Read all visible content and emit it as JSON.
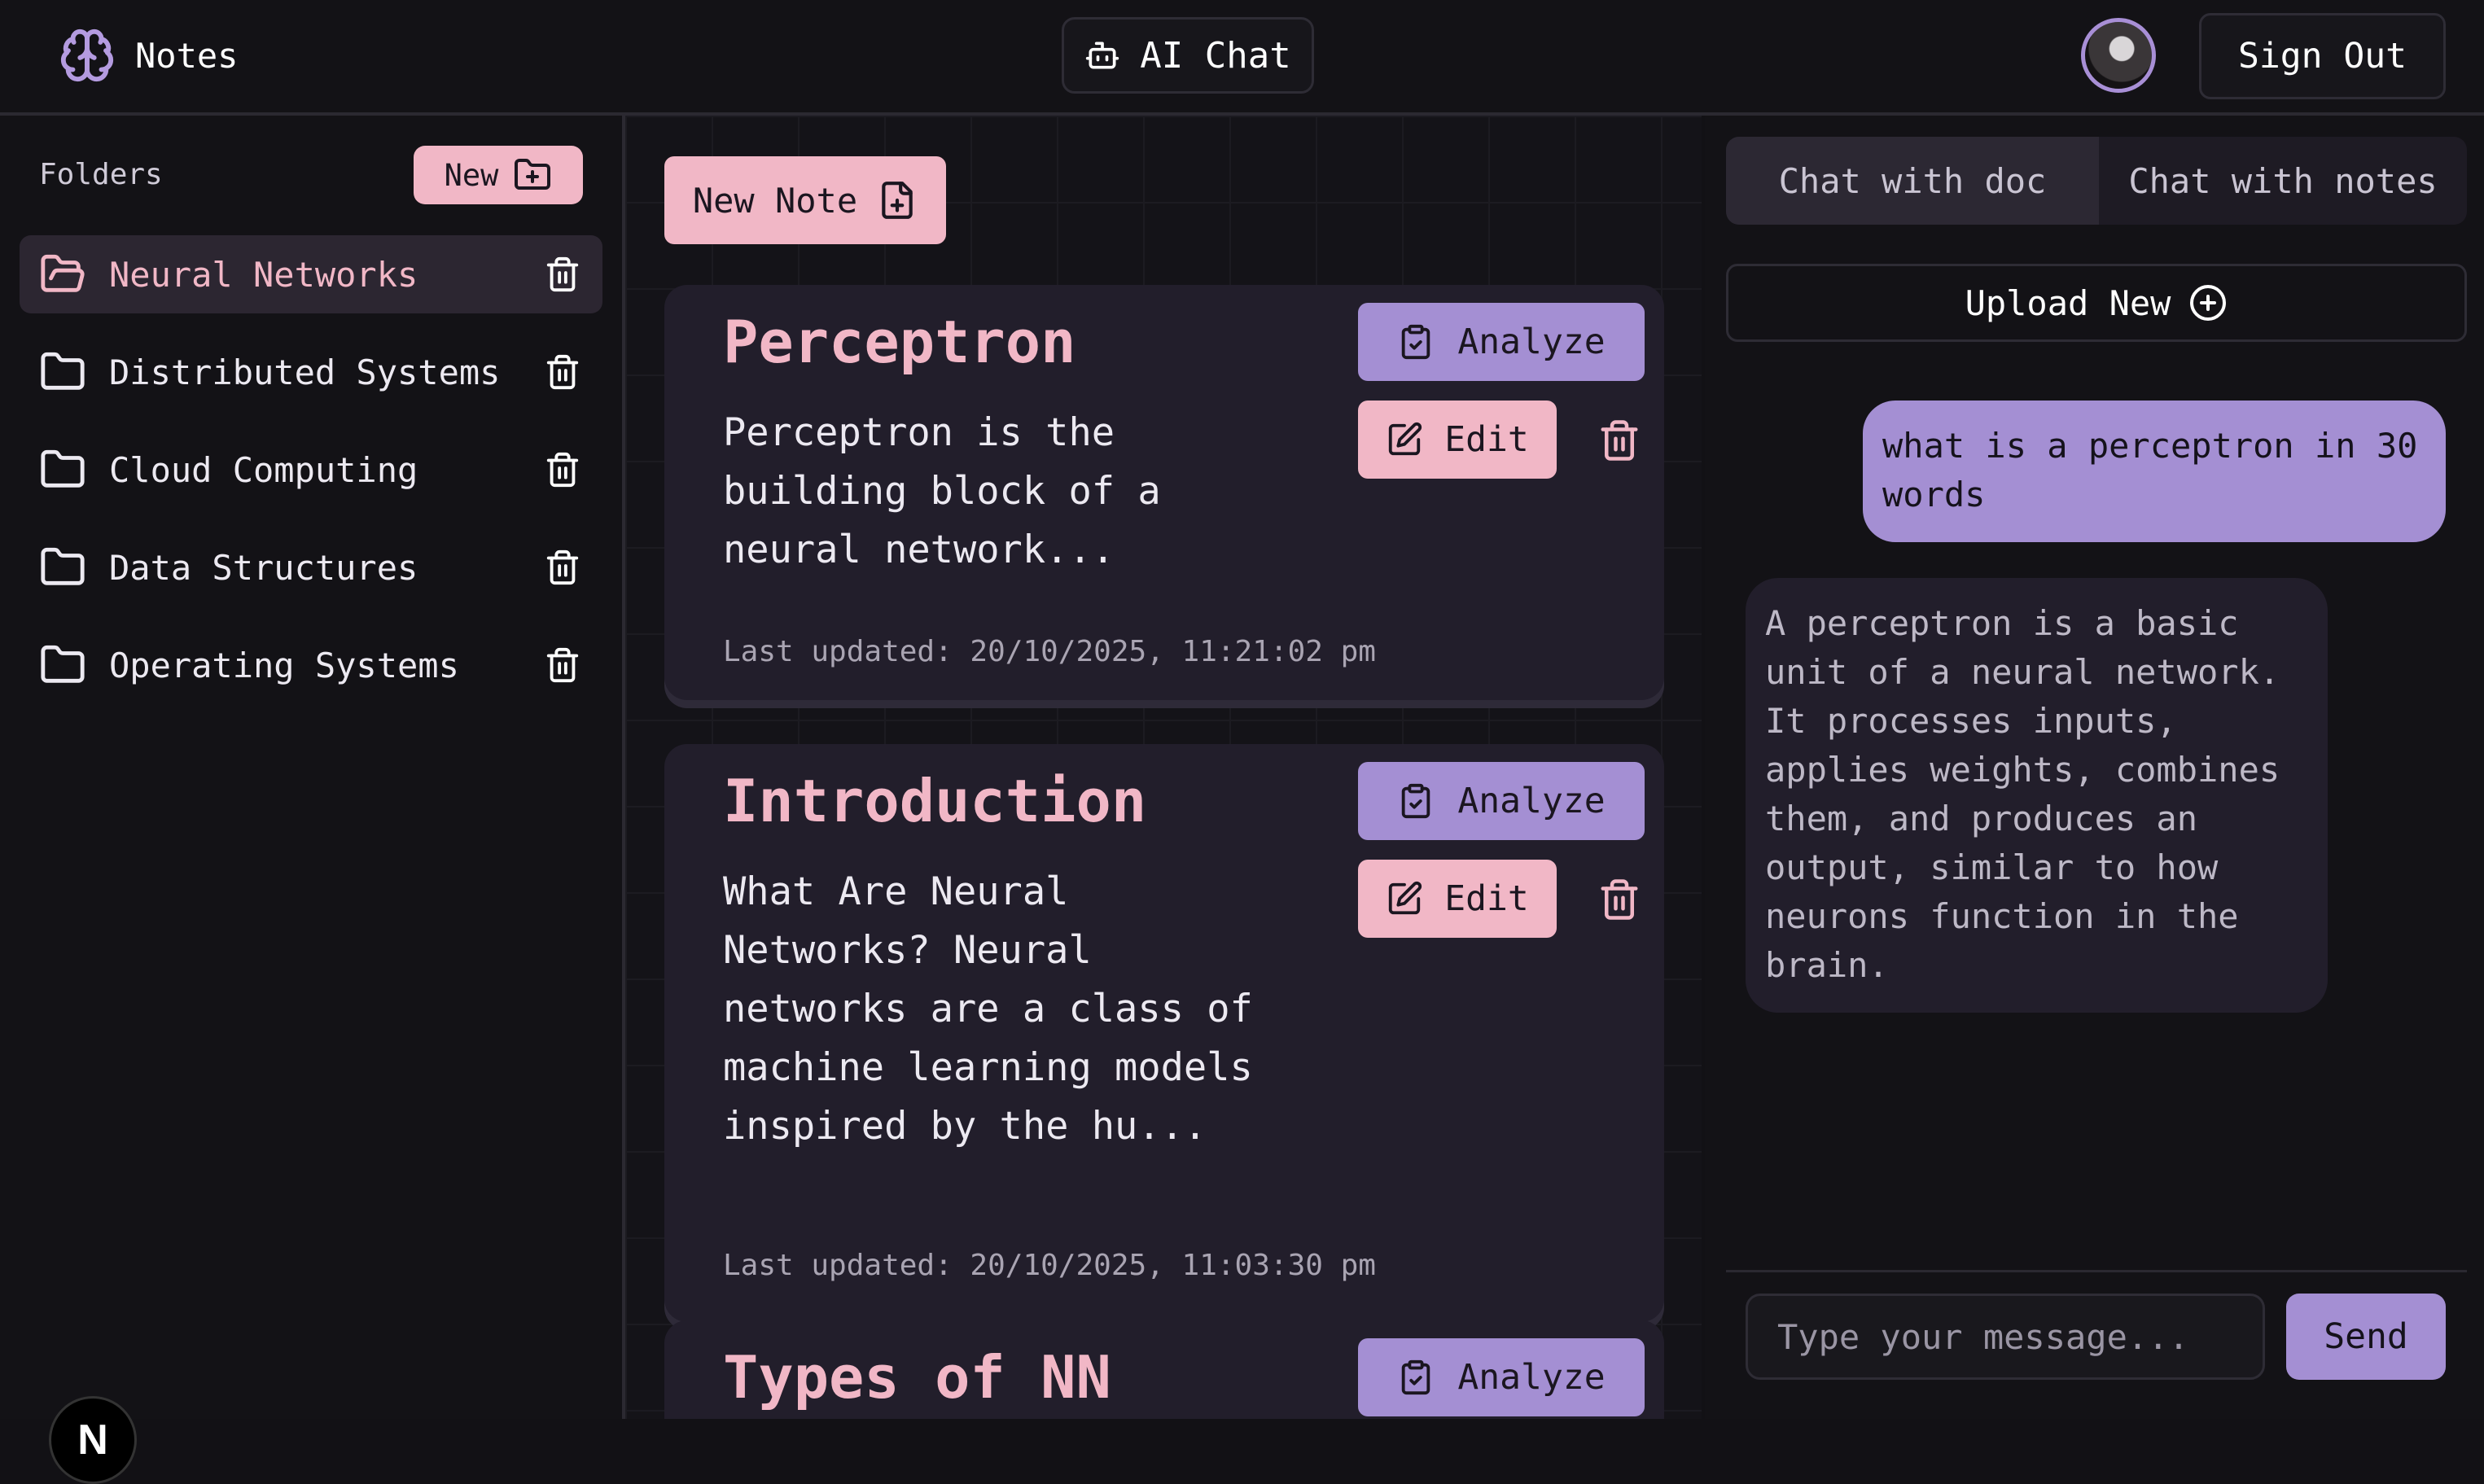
{
  "header": {
    "app_title": "Notes",
    "ai_chat_label": "AI Chat",
    "sign_out_label": "Sign Out"
  },
  "sidebar": {
    "folders_label": "Folders",
    "new_label": "New",
    "folders": [
      {
        "name": "Neural Networks",
        "active": true
      },
      {
        "name": "Distributed Systems",
        "active": false
      },
      {
        "name": "Cloud Computing",
        "active": false
      },
      {
        "name": "Data Structures",
        "active": false
      },
      {
        "name": "Operating Systems",
        "active": false
      }
    ],
    "badge_letter": "N"
  },
  "main": {
    "new_note_label": "New Note",
    "analyze_label": "Analyze",
    "edit_label": "Edit",
    "notes": [
      {
        "title": "Perceptron",
        "body": "Perceptron is the building block of a neural network...",
        "updated": "Last updated: 20/10/2025, 11:21:02 pm"
      },
      {
        "title": "Introduction",
        "body": "What Are Neural Networks? Neural networks are a class of machine learning models inspired by the hu...",
        "updated": "Last updated: 20/10/2025, 11:03:30 pm"
      },
      {
        "title": "Types of NN",
        "body": "",
        "updated": ""
      }
    ]
  },
  "chat": {
    "tab_doc": "Chat with doc",
    "tab_notes": "Chat with notes",
    "upload_label": "Upload New",
    "messages": [
      {
        "role": "user",
        "text": "what is a perceptron in 30 words"
      },
      {
        "role": "assistant",
        "text": "A perceptron is a basic unit of a neural network. It processes inputs, applies weights, combines them, and produces an output, similar to how neurons function in the brain."
      }
    ],
    "input_placeholder": "Type your message...",
    "send_label": "Send"
  },
  "colors": {
    "accent_pink": "#f1b7c6",
    "accent_purple": "#a48fd3",
    "background": "#121115",
    "card": "#221e2b"
  }
}
